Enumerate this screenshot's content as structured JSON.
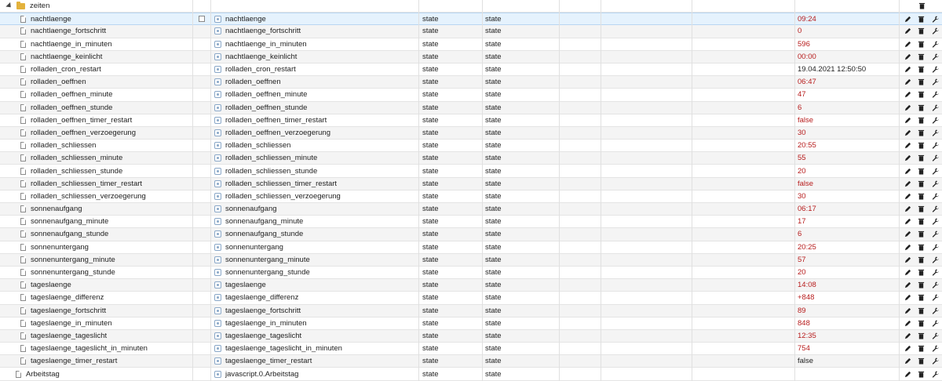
{
  "folder": {
    "name": "zeiten"
  },
  "rows": [
    {
      "id": "nachtlaenge",
      "name": "nachtlaenge",
      "role": "state",
      "type": "state",
      "value": "09:24",
      "value_color": "red",
      "selected": true
    },
    {
      "id": "nachtlaenge_fortschritt",
      "name": "nachtlaenge_fortschritt",
      "role": "state",
      "type": "state",
      "value": "0",
      "value_color": "red"
    },
    {
      "id": "nachtlaenge_in_minuten",
      "name": "nachtlaenge_in_minuten",
      "role": "state",
      "type": "state",
      "value": "596",
      "value_color": "red"
    },
    {
      "id": "nachtlaenge_keinlicht",
      "name": "nachtlaenge_keinlicht",
      "role": "state",
      "type": "state",
      "value": "00:00",
      "value_color": "red"
    },
    {
      "id": "rolladen_cron_restart",
      "name": "rolladen_cron_restart",
      "role": "state",
      "type": "state",
      "value": "19.04.2021 12:50:50",
      "value_color": "black"
    },
    {
      "id": "rolladen_oeffnen",
      "name": "rolladen_oeffnen",
      "role": "state",
      "type": "state",
      "value": "06:47",
      "value_color": "red"
    },
    {
      "id": "rolladen_oeffnen_minute",
      "name": "rolladen_oeffnen_minute",
      "role": "state",
      "type": "state",
      "value": "47",
      "value_color": "red"
    },
    {
      "id": "rolladen_oeffnen_stunde",
      "name": "rolladen_oeffnen_stunde",
      "role": "state",
      "type": "state",
      "value": "6",
      "value_color": "red"
    },
    {
      "id": "rolladen_oeffnen_timer_restart",
      "name": "rolladen_oeffnen_timer_restart",
      "role": "state",
      "type": "state",
      "value": "false",
      "value_color": "red"
    },
    {
      "id": "rolladen_oeffnen_verzoegerung",
      "name": "rolladen_oeffnen_verzoegerung",
      "role": "state",
      "type": "state",
      "value": "30",
      "value_color": "red"
    },
    {
      "id": "rolladen_schliessen",
      "name": "rolladen_schliessen",
      "role": "state",
      "type": "state",
      "value": "20:55",
      "value_color": "red"
    },
    {
      "id": "rolladen_schliessen_minute",
      "name": "rolladen_schliessen_minute",
      "role": "state",
      "type": "state",
      "value": "55",
      "value_color": "red"
    },
    {
      "id": "rolladen_schliessen_stunde",
      "name": "rolladen_schliessen_stunde",
      "role": "state",
      "type": "state",
      "value": "20",
      "value_color": "red"
    },
    {
      "id": "rolladen_schliessen_timer_restart",
      "name": "rolladen_schliessen_timer_restart",
      "role": "state",
      "type": "state",
      "value": "false",
      "value_color": "red"
    },
    {
      "id": "rolladen_schliessen_verzoegerung",
      "name": "rolladen_schliessen_verzoegerung",
      "role": "state",
      "type": "state",
      "value": "30",
      "value_color": "red"
    },
    {
      "id": "sonnenaufgang",
      "name": "sonnenaufgang",
      "role": "state",
      "type": "state",
      "value": "06:17",
      "value_color": "red"
    },
    {
      "id": "sonnenaufgang_minute",
      "name": "sonnenaufgang_minute",
      "role": "state",
      "type": "state",
      "value": "17",
      "value_color": "red"
    },
    {
      "id": "sonnenaufgang_stunde",
      "name": "sonnenaufgang_stunde",
      "role": "state",
      "type": "state",
      "value": "6",
      "value_color": "red"
    },
    {
      "id": "sonnenuntergang",
      "name": "sonnenuntergang",
      "role": "state",
      "type": "state",
      "value": "20:25",
      "value_color": "red"
    },
    {
      "id": "sonnenuntergang_minute",
      "name": "sonnenuntergang_minute",
      "role": "state",
      "type": "state",
      "value": "57",
      "value_color": "red"
    },
    {
      "id": "sonnenuntergang_stunde",
      "name": "sonnenuntergang_stunde",
      "role": "state",
      "type": "state",
      "value": "20",
      "value_color": "red"
    },
    {
      "id": "tageslaenge",
      "name": "tageslaenge",
      "role": "state",
      "type": "state",
      "value": "14:08",
      "value_color": "red"
    },
    {
      "id": "tageslaenge_differenz",
      "name": "tageslaenge_differenz",
      "role": "state",
      "type": "state",
      "value": "+848",
      "value_color": "red"
    },
    {
      "id": "tageslaenge_fortschritt",
      "name": "tageslaenge_fortschritt",
      "role": "state",
      "type": "state",
      "value": "89",
      "value_color": "red"
    },
    {
      "id": "tageslaenge_in_minuten",
      "name": "tageslaenge_in_minuten",
      "role": "state",
      "type": "state",
      "value": "848",
      "value_color": "red"
    },
    {
      "id": "tageslaenge_tageslicht",
      "name": "tageslaenge_tageslicht",
      "role": "state",
      "type": "state",
      "value": "12:35",
      "value_color": "red"
    },
    {
      "id": "tageslaenge_tageslicht_in_minuten",
      "name": "tageslaenge_tageslicht_in_minuten",
      "role": "state",
      "type": "state",
      "value": "754",
      "value_color": "red"
    },
    {
      "id": "tageslaenge_timer_restart",
      "name": "tageslaenge_timer_restart",
      "role": "state",
      "type": "state",
      "value": "false",
      "value_color": "black"
    },
    {
      "id": "Arbeitstag",
      "name": "javascript.0.Arbeitstag",
      "role": "state",
      "type": "state",
      "value": "",
      "value_color": "black",
      "outer": true
    }
  ],
  "colors": {
    "value_red": "#b71c1c",
    "selected_bg": "#e5f2fd",
    "alt_bg": "#f4f4f4"
  },
  "icons": {
    "folder": "folder-icon",
    "state": "file-icon",
    "object": "object-icon",
    "edit": "pencil-icon",
    "delete": "trash-icon",
    "custom": "wrench-icon"
  }
}
